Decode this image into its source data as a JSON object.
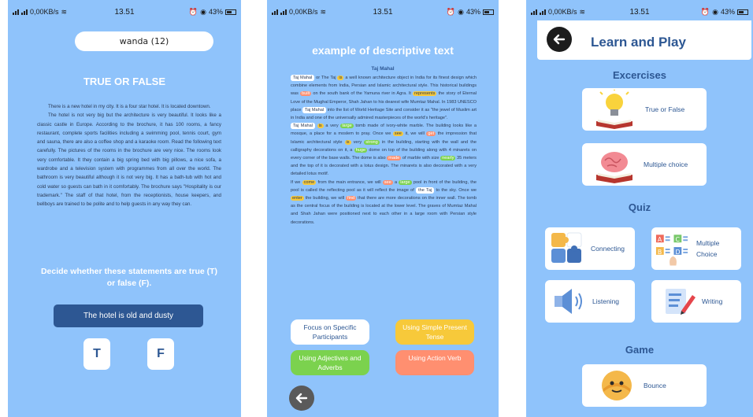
{
  "status": {
    "network": "0,00KB/s",
    "time": "13.51",
    "battery": "43%"
  },
  "screen1": {
    "name": "wanda (12)",
    "title": "TRUE OR FALSE",
    "paragraphs": [
      "There is a new hotel in my city. It is a four star hotel. It is located downtown.",
      "The hotel is not very big but the architecture is very beautiful. It looks like a classic castle in Europe. According to the brochure, it has 100 rooms, a fancy restaurant, complete sports facilities including a swimming pool, tennis court, gym and sauna, there are also a coffee shop and a karaoke room. Read the following text carefully. The pictures of the rooms in the brochure are very nice. The rooms look very comfortable. It they contain a big spring bed with big pillows, a nice sofa, a wardrobe and a television system with programmes from all over the world. The bathroom is very beautiful although it is not very big. It has a bath-tub with hot and cold water so guests can bath in it comfortably. The brochure says \"Hospitality is our trademark.\" The staff of that hotel, from the receptionists, house keepers, and bellboys are trained to be polite and to help guests in any way they can."
    ],
    "instruction": "Decide whether these statements are true (T) or false (F).",
    "statement": "The hotel is old and dusty",
    "true_label": "T",
    "false_label": "F"
  },
  "screen2": {
    "title": "example of descriptive text",
    "text_title": "Taj Mahal",
    "p1": {
      "a": "Taj Mahal",
      "b": " or The Taj ",
      "c": "is",
      "d": " a well known architecture object in India for its finest design which combine elements from India, Persian and Islamic architectural style. This historical buildings was ",
      "e": "built",
      "f": " on the south bank of the Yamuna river in Agra. It ",
      "g": "represents",
      "h": " the story of Eternal Love of the Mughal Emperor, Shah Jahan to his dearest wife Mumtaz Mahal. In 1983 UNESCO place ",
      "i": "Taj Mahal",
      "j": " into the list of World Heritage Site and consider it as \"the jewel of Muslim art in India and one of the universally admired masterpieces of the world's heritage\"."
    },
    "p2": {
      "a": "Taj Mahal",
      "b": " ",
      "c": "is",
      "d": " a very ",
      "e": "large",
      "f": " tomb made of ivory-white marble. The building looks like a mosque, a place for a moslem to pray. Once we ",
      "g": "see",
      "h": " it, we will ",
      "i": "get",
      "j": " the impression that Islamic architectural style ",
      "k": "is",
      "l": " very ",
      "m": "strong",
      "n": " in the building, starting with the wall and the calligraphy decorations on it, a ",
      "o": "huge",
      "p": " dome on top of the building along with 4 minarets on every corner of the base walls. The dome is also ",
      "q": "made",
      "r": " of marble with size ",
      "s": "nearly",
      "t": " 35 meters and the top of it is decorated with a lotus design. The minarets is also decorated with a very detailed lotus motif."
    },
    "p3": {
      "a": "If we ",
      "b": "come",
      "c": " from the main entrance, we will ",
      "d": "see",
      "e": " a ",
      "f": "large",
      "g": " pool in front of the building, the pool is called the reflecting pool as it will reflect the image of ",
      "h": "the Taj",
      "i": " to the sky. Once we ",
      "j": "enter",
      "k": " the building, we will ",
      "l": "find",
      "m": " that there are more decorations on the inner wall. The tomb as the central focus of the building is located at the lower level. The graves of Mumtaz Mahal and Shah Jahan were positioned next to each other in a large room with Persian style decorations."
    },
    "legend": [
      {
        "label": "Focus on Specific Participants",
        "bg": "#ffffff",
        "fg": "#2d5793"
      },
      {
        "label": "Using Simple Present Tense",
        "bg": "#f7c93a",
        "fg": "#ffffff"
      },
      {
        "label": "Using Adjectives and Adverbs",
        "bg": "#7bd24e",
        "fg": "#ffffff"
      },
      {
        "label": "Using Action Verb",
        "bg": "#ff8f70",
        "fg": "#ffffff"
      }
    ]
  },
  "screen3": {
    "title": "Learn and Play",
    "sections": {
      "exercises": "Excercises",
      "quiz": "Quiz",
      "game": "Game"
    },
    "exercises": [
      {
        "label": "True or False",
        "icon": "lightbulb-book-icon"
      },
      {
        "label": "Multiple choice",
        "icon": "brain-book-icon"
      }
    ],
    "quiz": [
      {
        "label": "Connecting",
        "icon": "puzzle-icon"
      },
      {
        "label": "Multiple Choice",
        "icon": "choice-cards-icon"
      },
      {
        "label": "Listening",
        "icon": "speaker-icon"
      },
      {
        "label": "Writing",
        "icon": "document-pen-icon"
      }
    ],
    "game": [
      {
        "label": "Bounce",
        "icon": "bounce-face-icon"
      }
    ]
  }
}
